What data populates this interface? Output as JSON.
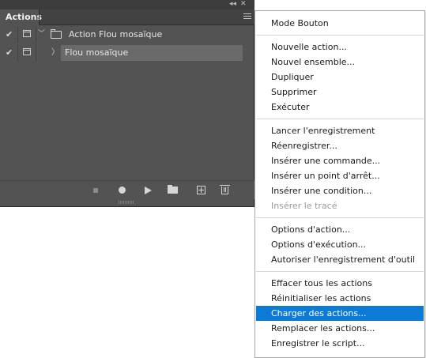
{
  "panel": {
    "tab_label": "Actions",
    "topbar": {
      "collapse_glyph": "◂◂",
      "close_glyph": "✕"
    },
    "rows": [
      {
        "checked": true,
        "label": "Action Flou mosaïque",
        "type": "set"
      },
      {
        "checked": true,
        "label": "Flou mosaïque",
        "type": "action"
      }
    ],
    "toolbar_icons": [
      "stop-icon",
      "record-icon",
      "play-icon",
      "new-set-icon",
      "new-action-icon",
      "trash-icon"
    ]
  },
  "menu": {
    "groups": [
      [
        {
          "label": "Mode Bouton"
        }
      ],
      [
        {
          "label": "Nouvelle action..."
        },
        {
          "label": "Nouvel ensemble..."
        },
        {
          "label": "Dupliquer"
        },
        {
          "label": "Supprimer"
        },
        {
          "label": "Exécuter"
        }
      ],
      [
        {
          "label": "Lancer l'enregistrement"
        },
        {
          "label": "Réenregistrer..."
        },
        {
          "label": "Insérer une commande..."
        },
        {
          "label": "Insérer un point d'arrêt..."
        },
        {
          "label": "Insérer une condition..."
        },
        {
          "label": "Insérer le tracé",
          "disabled": true
        }
      ],
      [
        {
          "label": "Options d'action..."
        },
        {
          "label": "Options d'exécution..."
        },
        {
          "label": "Autoriser l'enregistrement d'outil"
        }
      ],
      [
        {
          "label": "Effacer tous les actions"
        },
        {
          "label": "Réinitialiser les actions"
        },
        {
          "label": "Charger des actions...",
          "selected": true
        },
        {
          "label": "Remplacer les actions..."
        },
        {
          "label": "Enregistrer le script..."
        }
      ]
    ]
  },
  "colors": {
    "panel_bg": "#535353",
    "selection": "#0b7bd7"
  }
}
